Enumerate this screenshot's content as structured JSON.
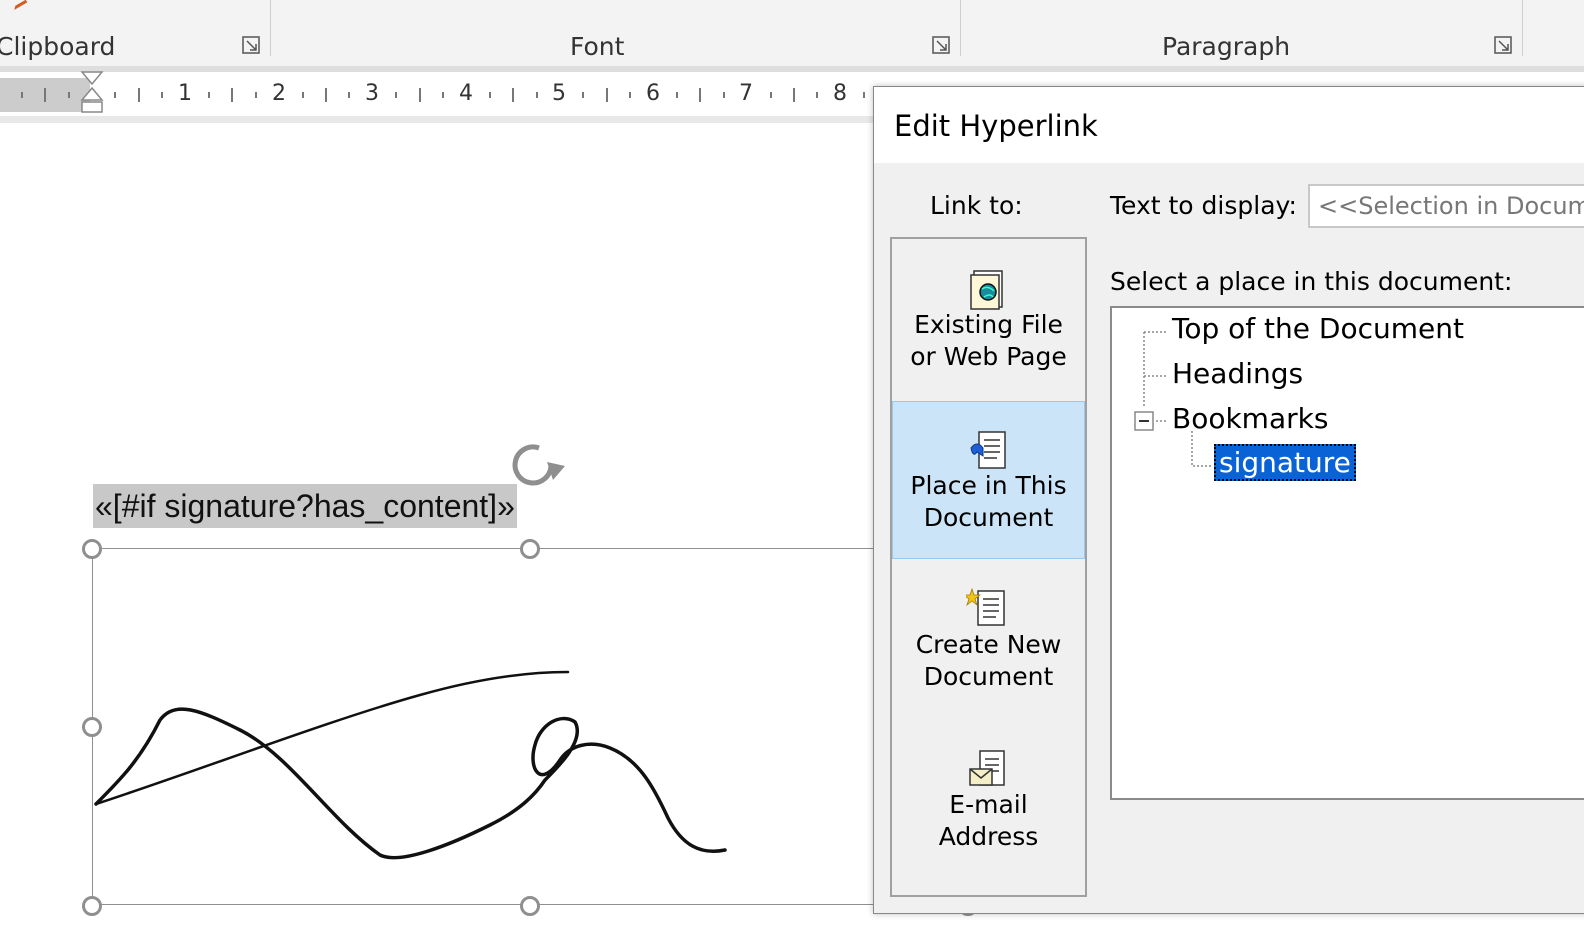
{
  "ribbon": {
    "groups": [
      {
        "label": "Clipboard"
      },
      {
        "label": "Font"
      },
      {
        "label": "Paragraph"
      }
    ]
  },
  "ruler": {
    "numbers": [
      "1",
      "2",
      "3",
      "4",
      "5",
      "6",
      "7",
      "8"
    ]
  },
  "document": {
    "field_text": "«[#if signature?has_content]»"
  },
  "dialog": {
    "title": "Edit Hyperlink",
    "link_to_label": "Link to:",
    "nav_items": [
      {
        "label": "Existing File\nor Web Page",
        "icon": "globe-file-icon",
        "selected": false
      },
      {
        "label": "Place in This\nDocument",
        "icon": "place-in-document-icon",
        "selected": true
      },
      {
        "label": "Create New\nDocument",
        "icon": "new-document-icon",
        "selected": false
      },
      {
        "label": "E-mail\nAddress",
        "icon": "email-icon",
        "selected": false
      }
    ],
    "text_to_display_label": "Text to display:",
    "text_to_display_value": "<<Selection in Document>>",
    "select_place_label": "Select a place in this document:",
    "tree": {
      "top": "Top of the Document",
      "headings": "Headings",
      "bookmarks": "Bookmarks",
      "bookmark_items": [
        "signature"
      ]
    }
  },
  "colors": {
    "selection_blue": "#0a63d6",
    "nav_selected_bg": "#cce4f7",
    "field_highlight": "#c8c8c8"
  }
}
